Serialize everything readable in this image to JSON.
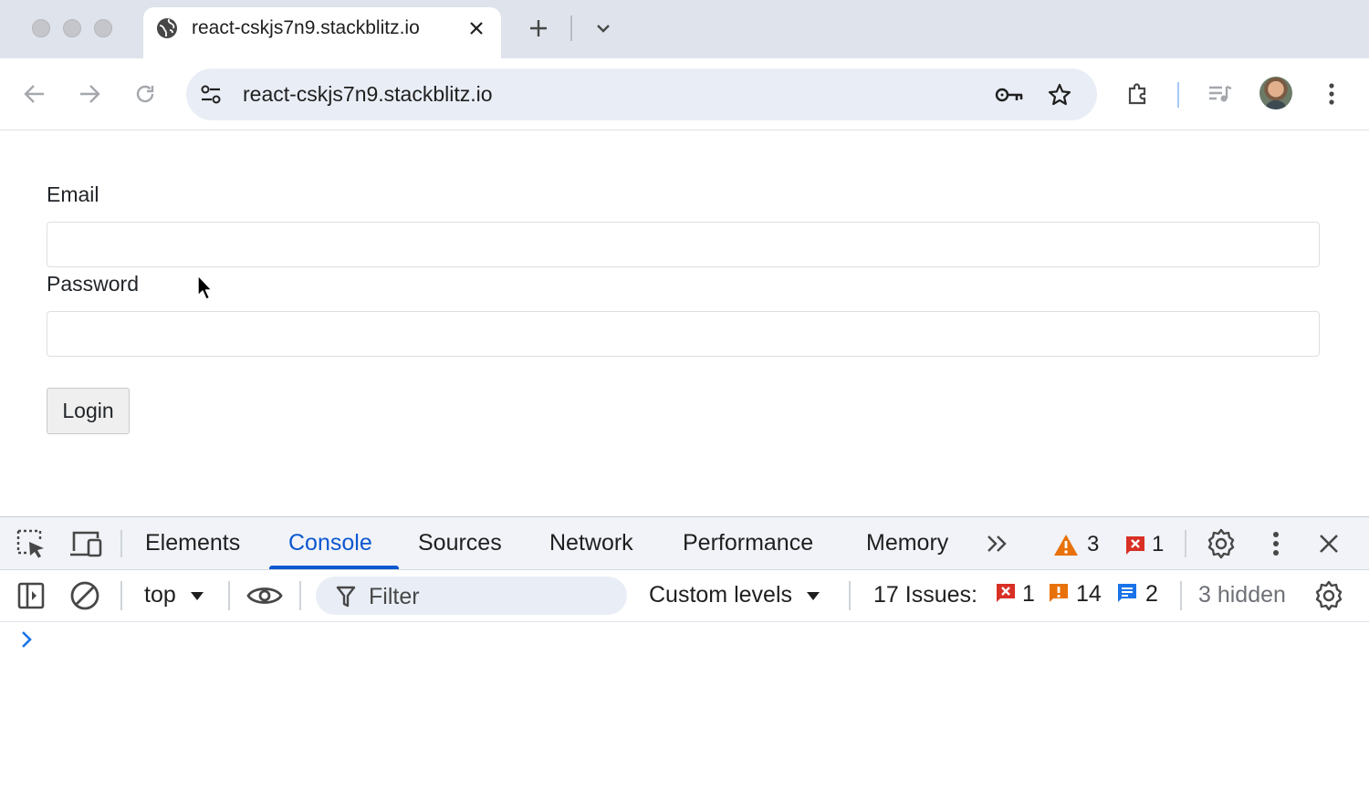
{
  "browser": {
    "tab": {
      "title": "react-cskjs7n9.stackblitz.io",
      "favicon": "globe-icon"
    },
    "address_bar": {
      "url": "react-cskjs7n9.stackblitz.io"
    },
    "icons": [
      "back-icon",
      "forward-icon",
      "reload-icon",
      "tune-icon",
      "key-icon",
      "star-icon",
      "extensions-icon",
      "media-icon",
      "menu-icon"
    ]
  },
  "page": {
    "email_label": "Email",
    "email_value": "",
    "password_label": "Password",
    "password_value": "",
    "login_button": "Login"
  },
  "devtools": {
    "tabs": [
      {
        "label": "Elements"
      },
      {
        "label": "Console",
        "active": true
      },
      {
        "label": "Sources"
      },
      {
        "label": "Network"
      },
      {
        "label": "Performance"
      },
      {
        "label": "Memory"
      }
    ],
    "warnings_count": "3",
    "errors_count": "1",
    "console": {
      "context": "top",
      "filter_placeholder": "Filter",
      "levels": "Custom levels",
      "issues_label": "17 Issues:",
      "issues_errors": "1",
      "issues_warnings": "14",
      "issues_info": "2",
      "hidden": "3 hidden"
    }
  },
  "colors": {
    "accent": "#0b57d0",
    "warning": "#e8710a",
    "error": "#d93025",
    "info": "#1a73e8"
  }
}
